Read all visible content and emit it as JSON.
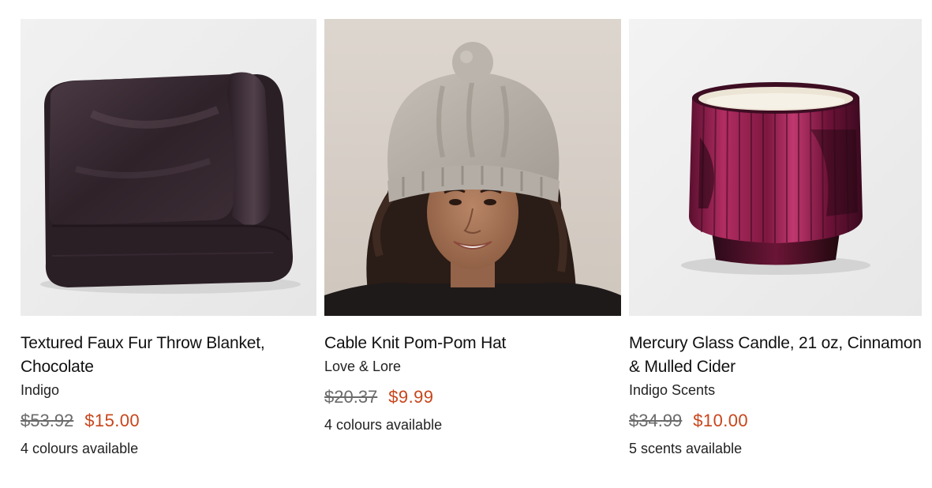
{
  "colors": {
    "sale": "#c8451b",
    "old_price": "#6b6b6b",
    "text": "#111111"
  },
  "products": [
    {
      "title": "Textured Faux Fur Throw Blanket, Chocolate",
      "brand": "Indigo",
      "old_price": "$53.92",
      "sale_price": "$15.00",
      "availability": "4 colours available",
      "image": "folded-chocolate-faux-fur-blanket"
    },
    {
      "title": "Cable Knit Pom-Pom Hat",
      "brand": "Love & Lore",
      "old_price": "$20.37",
      "sale_price": "$9.99",
      "availability": "4 colours available",
      "image": "woman-wearing-grey-knit-pom-pom-hat"
    },
    {
      "title": "Mercury Glass Candle, 21 oz, Cinnamon & Mulled Cider",
      "brand": "Indigo Scents",
      "old_price": "$34.99",
      "sale_price": "$10.00",
      "availability": "5 scents available",
      "image": "magenta-ribbed-mercury-glass-candle"
    }
  ]
}
